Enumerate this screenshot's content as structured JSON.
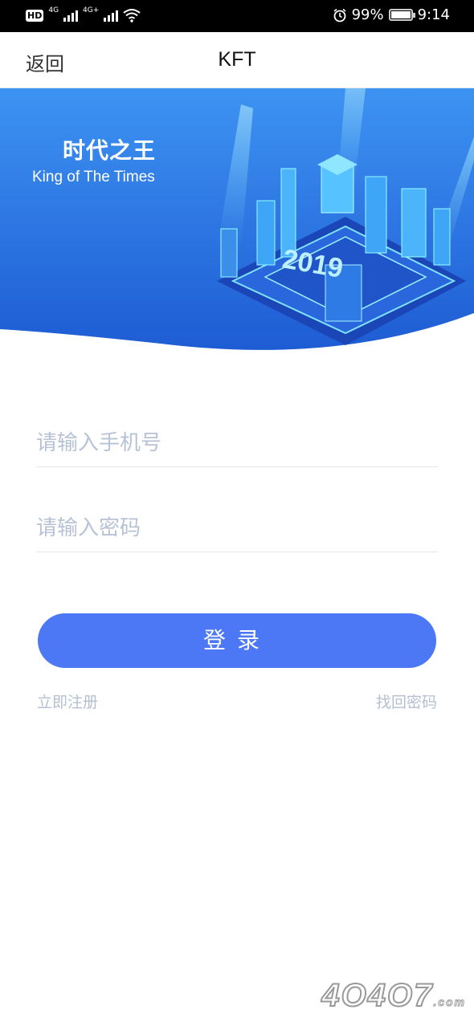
{
  "status_bar": {
    "left_badge": "HD",
    "network_1": "4G",
    "network_2": "4G+",
    "battery_percent": "99%",
    "battery_level": 0.99,
    "time": "9:14",
    "icons": [
      "hd-icon",
      "signal-icon",
      "signal-icon",
      "wifi-icon",
      "alarm-icon",
      "battery-icon"
    ]
  },
  "nav": {
    "back_label": "返回",
    "title": "KFT"
  },
  "banner": {
    "title": "时代之王",
    "subtitle": "King of  The Times",
    "image_label": "2019",
    "colors": {
      "bg_top": "#3b8ef0",
      "bg_bottom": "#1f5fd6"
    }
  },
  "form": {
    "phone_placeholder": "请输入手机号",
    "phone_value": "",
    "password_placeholder": "请输入密码",
    "password_value": "",
    "login_label": "登录",
    "register_label": "立即注册",
    "forgot_label": "找回密码",
    "accent_color": "#4d78f5"
  },
  "watermark": {
    "text": "4O4O7",
    "suffix": ".com"
  }
}
